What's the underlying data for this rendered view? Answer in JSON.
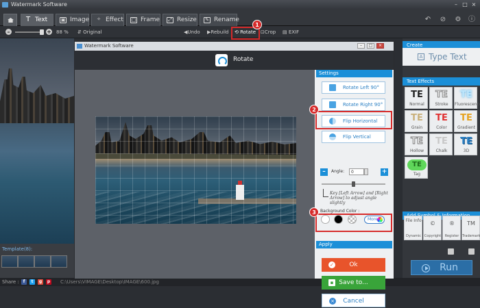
{
  "window": {
    "title": "Watermark Software"
  },
  "tabs": [
    {
      "label": "Text",
      "glyph": "T"
    },
    {
      "label": "Image",
      "glyph": "▣"
    },
    {
      "label": "Effect",
      "glyph": "✧"
    },
    {
      "label": "Frame",
      "glyph": "□"
    },
    {
      "label": "Resize",
      "glyph": "⤢"
    },
    {
      "label": "Rename",
      "glyph": "✎"
    }
  ],
  "toolbar": {
    "zoom": "88 %",
    "original": "Original",
    "undo": "Undo",
    "rebuild": "Rebuild",
    "rotate": "Rotate",
    "crop": "Crop",
    "exif": "EXIF"
  },
  "template": {
    "label": "Template(8):"
  },
  "status": {
    "share": "Share :",
    "path": "C:\\Users\\VIMAGE\\Desktop\\IMAGE\\600.jpg"
  },
  "right_panel": {
    "create_header": "Create",
    "type_text": "Type Text",
    "text_effects_header": "Text Effects",
    "effects": [
      {
        "glyph": "TE",
        "label": "Normal",
        "color": "#222222"
      },
      {
        "glyph": "TE",
        "label": "Stroke",
        "color": "#9aa0a6"
      },
      {
        "glyph": "TE",
        "label": "Fluorescence",
        "color": "#7ec8f0"
      },
      {
        "glyph": "TE",
        "label": "Grain",
        "color": "#c0a060"
      },
      {
        "glyph": "TE",
        "label": "Color",
        "color": "#e03030"
      },
      {
        "glyph": "TE",
        "label": "Gradient",
        "color": "#e0a020"
      },
      {
        "glyph": "TE",
        "label": "Hollow",
        "color": "#888888"
      },
      {
        "glyph": "TE",
        "label": "Chalk",
        "color": "#b8b8b8"
      },
      {
        "glyph": "TE",
        "label": "3D",
        "color": "#2a7fc3"
      },
      {
        "glyph": "TE",
        "label": "Tag",
        "color": "#3a8a2a"
      }
    ],
    "symbol_header": "Add Symbol & Information",
    "symbols": [
      {
        "glyph": "File Info",
        "label": "Dynamic"
      },
      {
        "glyph": "©",
        "label": "Copyright"
      },
      {
        "glyph": "®",
        "label": "Register"
      },
      {
        "glyph": "TM",
        "label": "Trademark"
      }
    ],
    "run": "Run"
  },
  "dialog": {
    "title": "Watermark Software",
    "header": "Rotate",
    "settings_header": "Settings",
    "rotate_left": "Rotate Left 90°",
    "rotate_right": "Rotate Right 90°",
    "flip_horizontal": "Flip Horizontal",
    "flip_vertical": "Flip Vertical",
    "angle_label": "Angle:",
    "angle_value": "0",
    "hint": "Key [Left Arrow] and [Right Arrow] to adjust angle slightly",
    "background_color_label": "Background Color :",
    "more": "More",
    "apply_header": "Apply",
    "ok": "Ok",
    "save": "Save to...",
    "cancel": "Cancel"
  },
  "callouts": [
    "1",
    "2",
    "3"
  ],
  "colors": {
    "accent": "#1b8fd8",
    "ok": "#e8542b",
    "save": "#39a43a",
    "highlight": "#d62a2a"
  }
}
